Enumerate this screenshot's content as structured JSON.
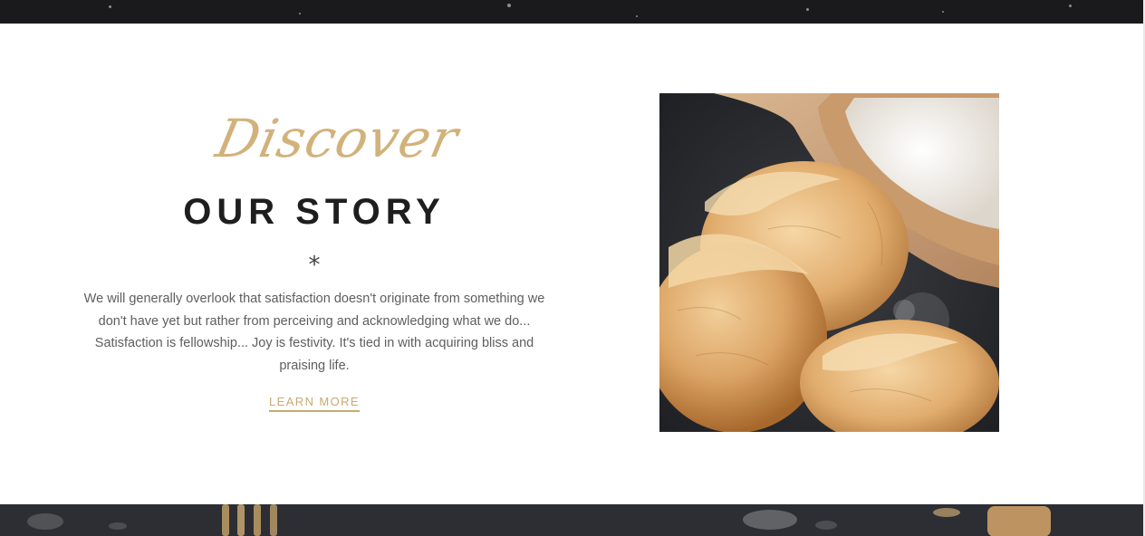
{
  "section": {
    "script_title": "Discover",
    "heading": "OUR STORY",
    "divider_symbol": "*",
    "body": "We will generally overlook that satisfaction doesn't originate from something we don't have yet but rather from perceiving and acknowledging what we do... Satisfaction is fellowship... Joy is festivity. It's tied in with acquiring bliss and praising life.",
    "cta_label": "LEARN MORE"
  },
  "colors": {
    "accent": "#c9a96e",
    "heading": "#1e1e1e",
    "body_text": "#5e5e5e",
    "dark_band": "#1a1a1c"
  },
  "images": {
    "hero_photo": "bread-rolls-with-flour-scoop"
  }
}
